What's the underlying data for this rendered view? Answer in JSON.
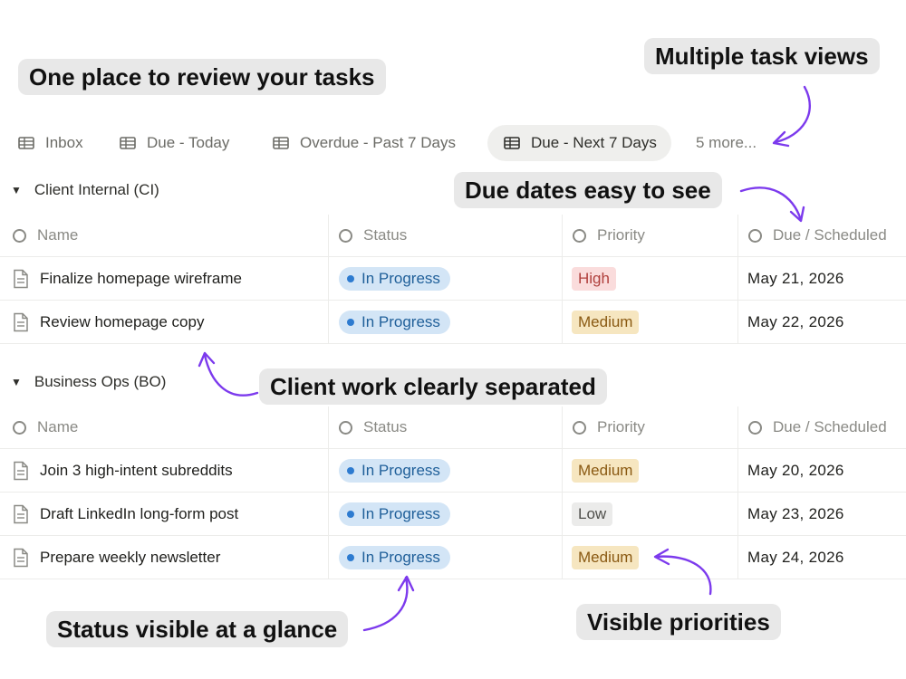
{
  "callouts": {
    "review": "One place to review your tasks",
    "views": "Multiple task views",
    "due": "Due dates easy to see",
    "client": "Client work clearly separated",
    "status": "Status visible at a glance",
    "priorities": "Visible priorities"
  },
  "tabs": [
    {
      "label": "Inbox",
      "icon": "table-icon"
    },
    {
      "label": "Due - Today",
      "icon": "table-icon"
    },
    {
      "label": "Overdue - Past 7 Days",
      "icon": "table-icon"
    },
    {
      "label": "Due - Next 7 Days",
      "icon": "table-icon",
      "active": true
    }
  ],
  "more_label": "5 more...",
  "columns": {
    "name": "Name",
    "status": "Status",
    "priority": "Priority",
    "due": "Due / Scheduled"
  },
  "groups": [
    {
      "title": "Client Internal (CI)",
      "rows": [
        {
          "name": "Finalize homepage wireframe",
          "status": "In Progress",
          "priority": "High",
          "due": "May 21, 2026"
        },
        {
          "name": "Review homepage copy",
          "status": "In Progress",
          "priority": "Medium",
          "due": "May 22, 2026"
        }
      ]
    },
    {
      "title": "Business Ops (BO)",
      "rows": [
        {
          "name": "Join 3 high-intent subreddits",
          "status": "In Progress",
          "priority": "Medium",
          "due": "May 20, 2026"
        },
        {
          "name": "Draft LinkedIn long-form post",
          "status": "In Progress",
          "priority": "Low",
          "due": "May 23, 2026"
        },
        {
          "name": "Prepare weekly newsletter",
          "status": "In Progress",
          "priority": "Medium",
          "due": "May 24, 2026"
        }
      ]
    }
  ],
  "colors": {
    "status_bg": "#d3e5f6",
    "status_text": "#1f5f99",
    "status_dot": "#2d7bd0",
    "priority_high_bg": "#fadcdc",
    "priority_high_text": "#b0403d",
    "priority_medium_bg": "#f6e6c0",
    "priority_medium_text": "#8a5a13",
    "priority_low_bg": "#ebebea",
    "priority_low_text": "#4f4f4b",
    "arrow": "#7c3aed"
  }
}
